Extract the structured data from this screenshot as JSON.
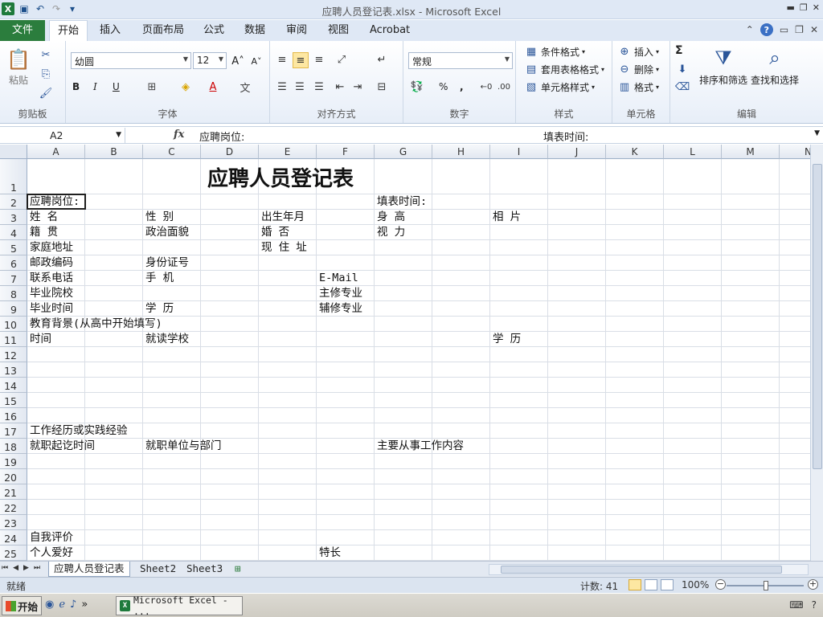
{
  "window": {
    "title": "应聘人员登记表.xlsx  -  Microsoft Excel"
  },
  "ribbon_tabs": [
    "文件",
    "开始",
    "插入",
    "页面布局",
    "公式",
    "数据",
    "审阅",
    "视图",
    "Acrobat"
  ],
  "clipboard": {
    "paste": "粘贴",
    "label": "剪贴板"
  },
  "font": {
    "name": "幼圆",
    "size": "12",
    "label": "字体",
    "bold": "B",
    "italic": "I",
    "underline": "U"
  },
  "alignment": {
    "label": "对齐方式"
  },
  "number": {
    "format": "常规",
    "percent": "%",
    "comma": ",",
    "label": "数字"
  },
  "styles": {
    "conditional": "条件格式",
    "table": "套用表格格式",
    "cell": "单元格样式",
    "label": "样式"
  },
  "cells": {
    "insert": "插入",
    "delete": "删除",
    "format": "格式",
    "label": "单元格"
  },
  "editing": {
    "sigma": "Σ",
    "sort": "排序和筛选",
    "find": "查找和选择",
    "label": "编辑"
  },
  "formula_bar": {
    "name_box": "A2",
    "fx": "fx",
    "content": "应聘岗位:",
    "content2": "填表时间:"
  },
  "columns": [
    "A",
    "B",
    "C",
    "D",
    "E",
    "F",
    "G",
    "H",
    "I",
    "J",
    "K",
    "L",
    "M",
    "N"
  ],
  "rows": [
    "1",
    "2",
    "3",
    "4",
    "5",
    "6",
    "7",
    "8",
    "9",
    "10",
    "11",
    "12",
    "13",
    "14",
    "15",
    "16",
    "17",
    "18",
    "19",
    "20",
    "21",
    "22",
    "23",
    "24",
    "25"
  ],
  "sheet": {
    "title": "应聘人员登记表",
    "r2_a": "应聘岗位:",
    "r2_g": "填表时间:",
    "r3_a": "姓    名",
    "r3_c": "性    别",
    "r3_e": "出生年月",
    "r3_g": "身    高",
    "r3_i": "相    片",
    "r4_a": "籍    贯",
    "r4_c": "政治面貌",
    "r4_e": "婚    否",
    "r4_g": "视  力",
    "r5_a": "家庭地址",
    "r5_e": "现 住 址",
    "r6_a": "邮政编码",
    "r6_c": "身份证号",
    "r7_a": "联系电话",
    "r7_c": "手    机",
    "r7_f": "E-Mail",
    "r8_a": "毕业院校",
    "r8_f": "主修专业",
    "r9_a": "毕业时间",
    "r9_c": "学    历",
    "r9_f": "辅修专业",
    "r10_a": "教育背景(从高中开始填写)",
    "r11_a": "时间",
    "r11_c": "就读学校",
    "r11_i": "学    历",
    "r17_a": "工作经历或实践经验",
    "r18_a": "就职起讫时间",
    "r18_c": "就职单位与部门",
    "r18_g": "主要从事工作内容",
    "r24_a": "自我评价",
    "r25_a": "个人爱好",
    "r25_f": "特长"
  },
  "sheet_tabs": [
    "应聘人员登记表",
    "Sheet2",
    "Sheet3"
  ],
  "status": {
    "ready": "就绪",
    "count": "计数: 41",
    "zoom": "100%",
    "zoom_minus": "−",
    "zoom_plus": "+"
  },
  "taskbar": {
    "start": "开始",
    "task": "Microsoft Excel - ...",
    "chevron": "»"
  }
}
